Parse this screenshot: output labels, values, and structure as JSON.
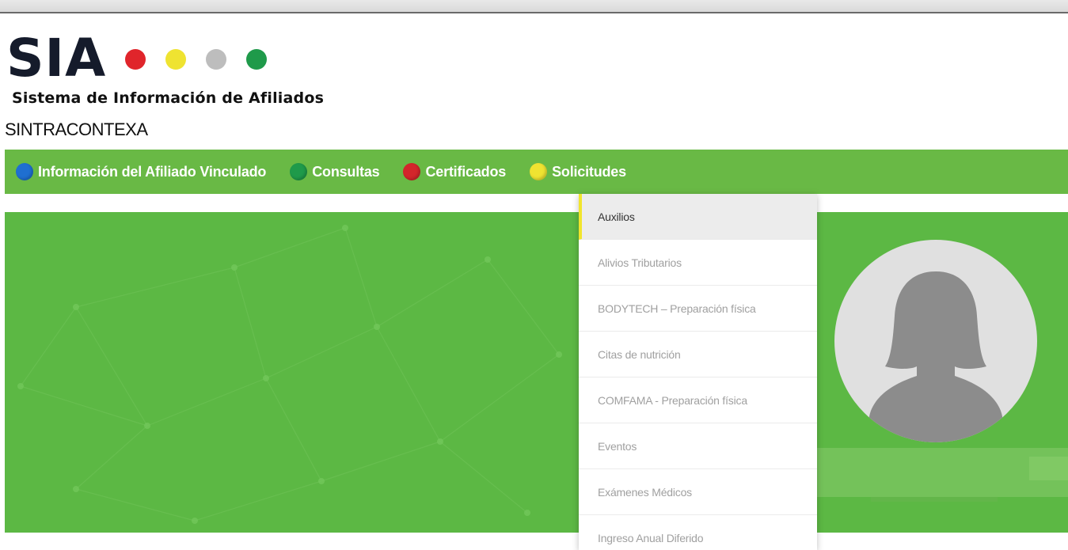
{
  "header": {
    "logo_text": "SIA",
    "subtitle": "Sistema de Información de Afiliados",
    "org_name": "SINTRACONTEXA",
    "logo_dot_colors": [
      "#e0252b",
      "#efe331",
      "#bdbdbd",
      "#1f9a4a"
    ]
  },
  "nav": {
    "items": [
      {
        "label": "Información del Afiliado Vinculado",
        "dot_color": "#1f6fd1"
      },
      {
        "label": "Consultas",
        "dot_color": "#1f9a4a"
      },
      {
        "label": "Certificados",
        "dot_color": "#d3262b"
      },
      {
        "label": "Solicitudes",
        "dot_color": "#efe331"
      }
    ]
  },
  "dropdown": {
    "active_index": 0,
    "items": [
      {
        "label": "Auxilios"
      },
      {
        "label": "Alivios Tributarios"
      },
      {
        "label": "BODYTECH – Preparación física"
      },
      {
        "label": "Citas de nutrición"
      },
      {
        "label": "COMFAMA - Preparación física"
      },
      {
        "label": "Eventos"
      },
      {
        "label": "Exámenes Médicos"
      },
      {
        "label": "Ingreso Anual Diferido"
      }
    ]
  },
  "colors": {
    "nav_bg": "#69b945",
    "hero_bg": "#5cb844",
    "active_indicator": "#f1e52d"
  },
  "icons": {
    "avatar": "user-silhouette-icon"
  }
}
